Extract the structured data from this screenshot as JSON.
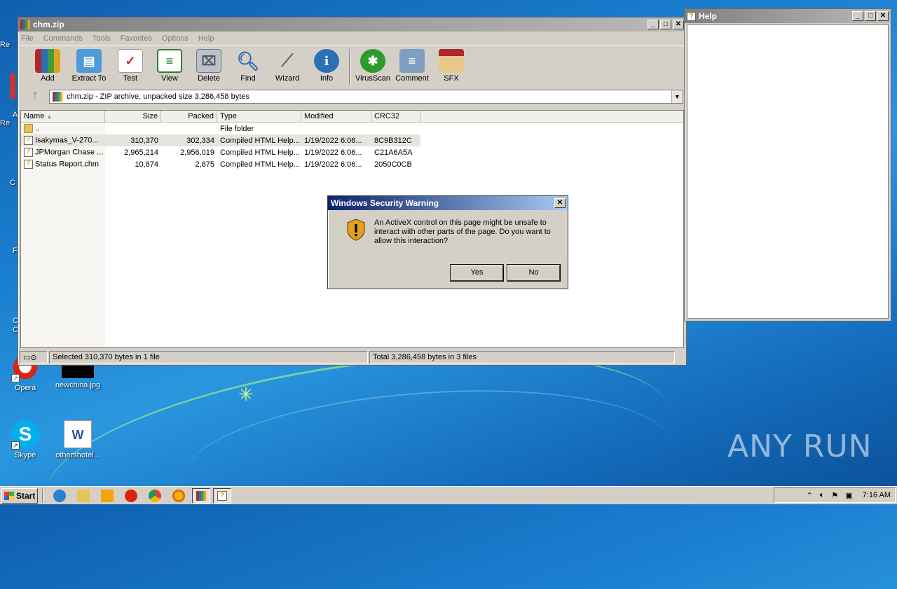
{
  "desktop": {
    "icons": [
      {
        "label": "Opera"
      },
      {
        "label": "newchina.jpg"
      },
      {
        "label": "Skype"
      },
      {
        "label": "othershotel..."
      }
    ],
    "side_labels": [
      "Re",
      "A",
      "Re",
      "C",
      "F",
      "C",
      "C"
    ]
  },
  "winrar": {
    "title": "chm.zip",
    "menu": [
      "File",
      "Commands",
      "Tools",
      "Favorites",
      "Options",
      "Help"
    ],
    "toolbar": [
      "Add",
      "Extract To",
      "Test",
      "View",
      "Delete",
      "Find",
      "Wizard",
      "Info",
      "VirusScan",
      "Comment",
      "SFX"
    ],
    "address": "chm.zip - ZIP archive, unpacked size 3,286,458 bytes",
    "columns": [
      "Name",
      "Size",
      "Packed",
      "Type",
      "Modified",
      "CRC32"
    ],
    "rows": [
      {
        "name": "..",
        "size": "",
        "packed": "",
        "type": "File folder",
        "modified": "",
        "crc": ""
      },
      {
        "name": "Isakymas_V-270...",
        "size": "310,370",
        "packed": "302,334",
        "type": "Compiled HTML Help...",
        "modified": "1/19/2022 6:06...",
        "crc": "8C9B312C"
      },
      {
        "name": "JPMorgan Chase ...",
        "size": "2,965,214",
        "packed": "2,956,019",
        "type": "Compiled HTML Help...",
        "modified": "1/19/2022 6:06...",
        "crc": "C21A6A5A"
      },
      {
        "name": "Status Report.chm",
        "size": "10,874",
        "packed": "2,875",
        "type": "Compiled HTML Help...",
        "modified": "1/19/2022 6:06...",
        "crc": "2050C0CB"
      }
    ],
    "status_left": "Selected 310,370 bytes in 1 file",
    "status_right": "Total 3,286,458 bytes in 3 files"
  },
  "help_window": {
    "title": "Help"
  },
  "dialog": {
    "title": "Windows Security Warning",
    "message": "An ActiveX control on this page might be unsafe to interact with other parts of the page. Do you want to allow this interaction?",
    "yes": "Yes",
    "no": "No"
  },
  "taskbar": {
    "start": "Start",
    "clock": "7:16 AM"
  },
  "watermark": "ANY RUN",
  "colors": {
    "dialog_title": "#0a246a",
    "desktop": "#1b7fd0",
    "window_face": "#d4d0c8"
  }
}
